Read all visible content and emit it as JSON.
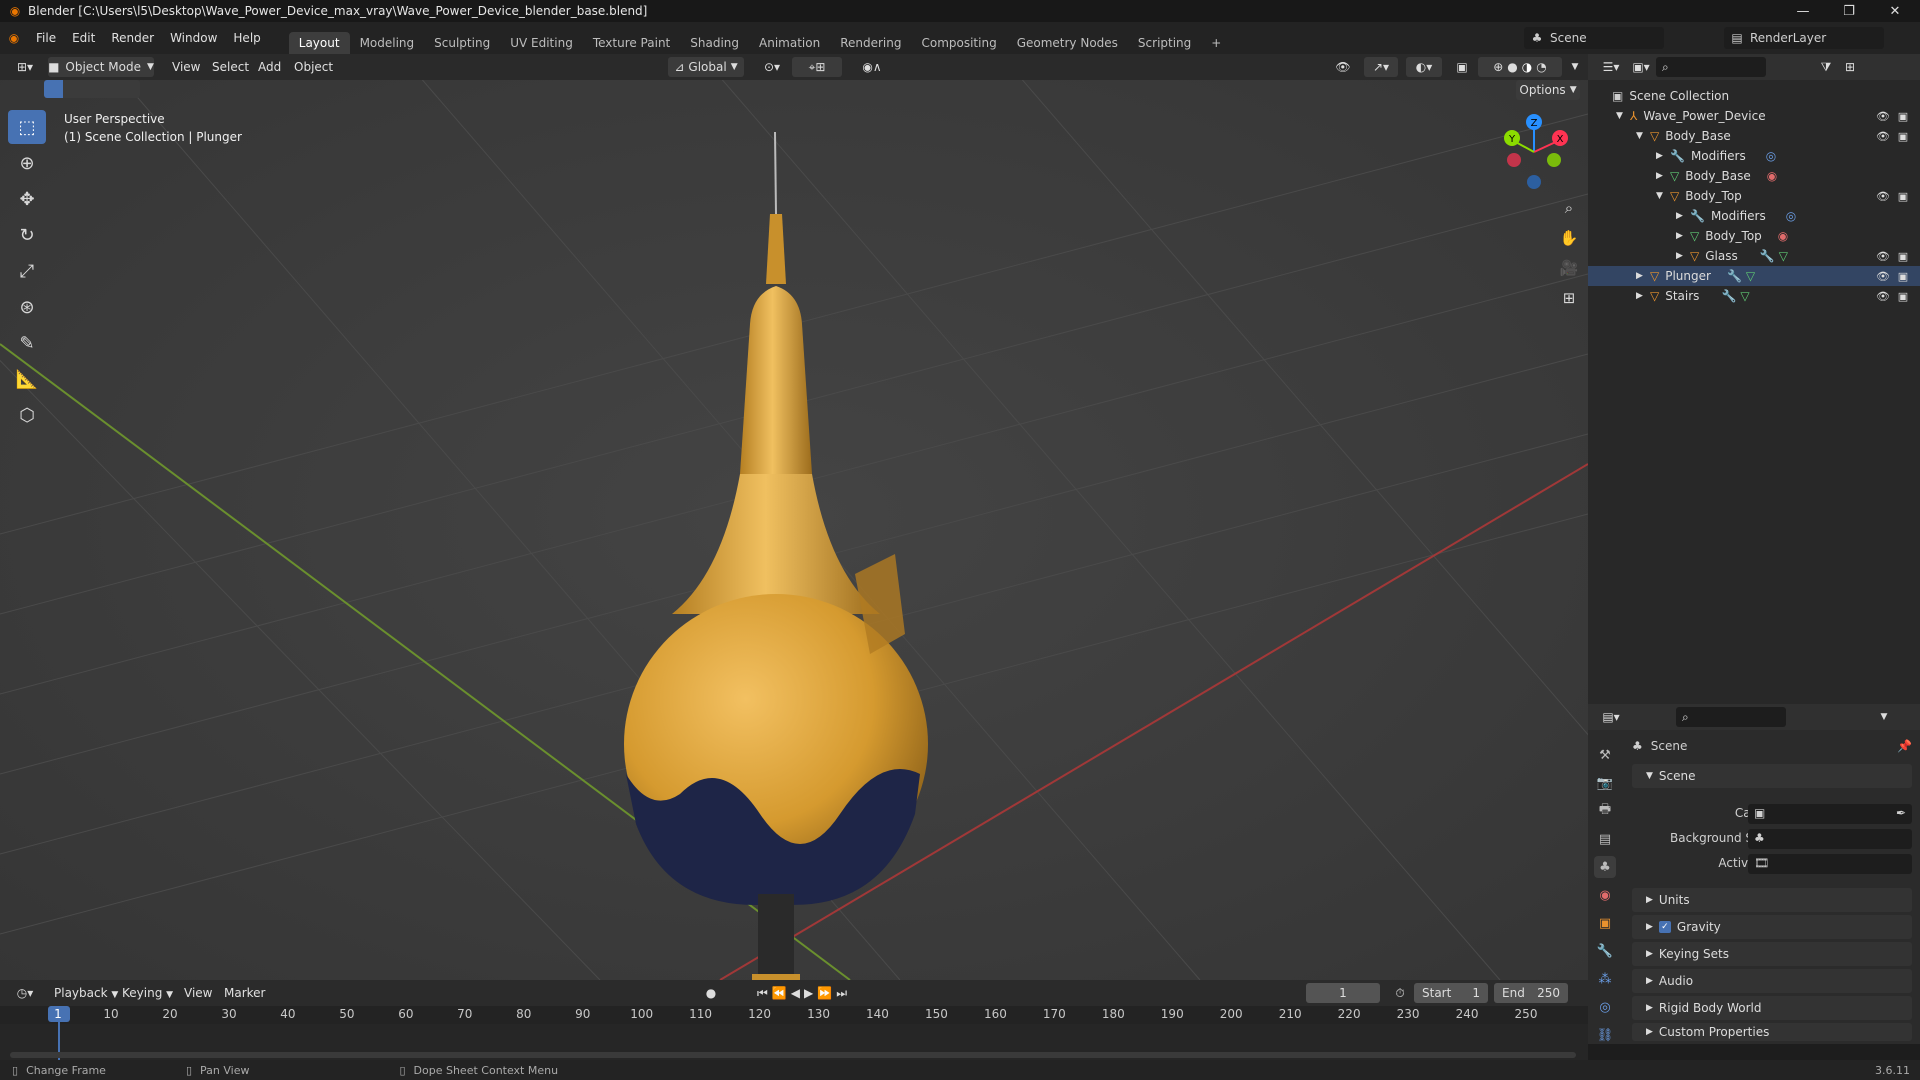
{
  "window": {
    "title": "Blender [C:\\Users\\l5\\Desktop\\Wave_Power_Device_max_vray\\Wave_Power_Device_blender_base.blend]",
    "minimize": "—",
    "maximize": "❐",
    "close": "✕"
  },
  "menu": [
    "File",
    "Edit",
    "Render",
    "Window",
    "Help"
  ],
  "workspaces": [
    "Layout",
    "Modeling",
    "Sculpting",
    "UV Editing",
    "Texture Paint",
    "Shading",
    "Animation",
    "Rendering",
    "Compositing",
    "Geometry Nodes",
    "Scripting"
  ],
  "workspace_add": "+",
  "scene_selector": {
    "value": "Scene"
  },
  "view_layer_selector": {
    "value": "RenderLayer"
  },
  "viewport_header": {
    "mode": "Object Mode",
    "menus": [
      "View",
      "Select",
      "Add",
      "Object"
    ],
    "orientation": "Global",
    "options_label": "Options"
  },
  "viewport_info": {
    "line1": "User Perspective",
    "line2": "(1) Scene Collection | Plunger"
  },
  "gizmo": {
    "x": "X",
    "y": "Y",
    "z": "Z"
  },
  "outliner": {
    "root": "Scene Collection",
    "items": [
      {
        "label": "Wave_Power_Device"
      },
      {
        "label": "Body_Base"
      },
      {
        "label": "Modifiers"
      },
      {
        "label": "Body_Base"
      },
      {
        "label": "Body_Top"
      },
      {
        "label": "Modifiers"
      },
      {
        "label": "Body_Top"
      },
      {
        "label": "Glass"
      },
      {
        "label": "Plunger"
      },
      {
        "label": "Stairs"
      }
    ]
  },
  "properties": {
    "header": "Scene",
    "panel_title": "Scene",
    "camera_label": "Camera",
    "background_scene_label": "Background Scene",
    "active_clip_label": "Active Clip",
    "sections": [
      "Units",
      "Gravity",
      "Keying Sets",
      "Audio",
      "Rigid Body World",
      "Custom Properties"
    ],
    "gravity_checked": true
  },
  "timeline": {
    "menus": [
      "Playback",
      "Keying",
      "View",
      "Marker"
    ],
    "current_frame": "1",
    "start_label": "Start",
    "start_value": "1",
    "end_label": "End",
    "end_value": "250",
    "ticks": [
      "1",
      "10",
      "20",
      "30",
      "40",
      "50",
      "60",
      "70",
      "80",
      "90",
      "100",
      "110",
      "120",
      "130",
      "140",
      "150",
      "160",
      "170",
      "180",
      "190",
      "200",
      "210",
      "220",
      "230",
      "240",
      "250"
    ]
  },
  "statusbar": {
    "hint1": "Change Frame",
    "hint2": "Pan View",
    "hint3": "Dope Sheet Context Menu",
    "version": "3.6.11"
  },
  "colors": {
    "accent": "#4772b3",
    "object_orange": "#e8922e",
    "x_axis": "#ff3352",
    "y_axis": "#8bdc00",
    "z_axis": "#2890ff",
    "buoy_yellow": "#d9a23a",
    "buoy_navy": "#1e2547"
  }
}
